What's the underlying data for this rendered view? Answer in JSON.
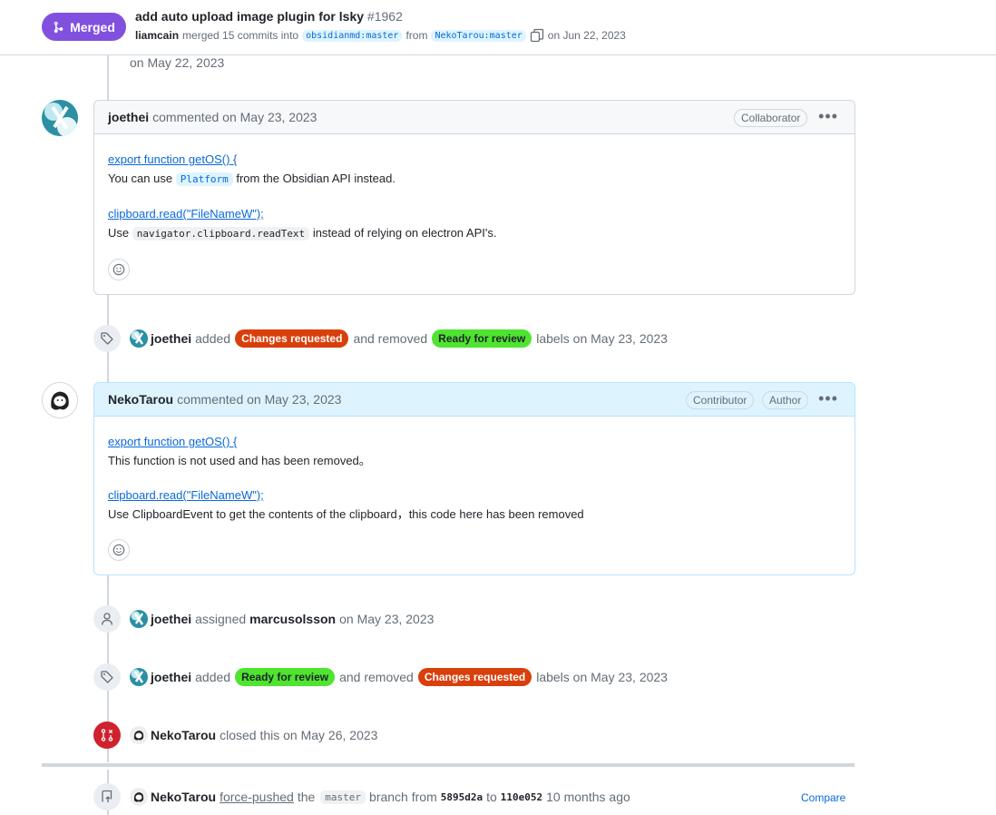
{
  "header": {
    "status": "Merged",
    "title": "add auto upload image plugin for lsky",
    "number": "#1962",
    "merger": "liamcain",
    "merged_text": "merged 15 commits into",
    "base_branch": "obsidianmd:master",
    "from_text": "from",
    "head_branch": "NekoTarou:master",
    "date_text": "on Jun 22, 2023"
  },
  "prev_date": "on May 22, 2023",
  "comment1": {
    "author": "joethei",
    "meta": "commented on May 23, 2023",
    "role": "Collaborator",
    "link1": "export function getOS() {",
    "line1_pre": "You can use",
    "line1_code": "Platform",
    "line1_post": "from the Obsidian API instead.",
    "link2": "clipboard.read(\"FileNameW\");",
    "line2_pre": "Use",
    "line2_code": "navigator.clipboard.readText",
    "line2_post": "instead of relying on electron API's."
  },
  "event1": {
    "actor": "joethei",
    "added": "added",
    "label_a": "Changes requested",
    "removed": "and removed",
    "label_b": "Ready for review",
    "tail": "labels on May 23, 2023"
  },
  "comment2": {
    "author": "NekoTarou",
    "meta": "commented on May 23, 2023",
    "role1": "Contributor",
    "role2": "Author",
    "link1": "export function getOS() {",
    "line1": "This function is not used and has been removed。",
    "link2": "clipboard.read(\"FileNameW\");",
    "line2": "Use ClipboardEvent to get the contents of the clipboard，this code here has been removed"
  },
  "event2": {
    "actor": "joethei",
    "assigned": "assigned",
    "assignee": "marcusolsson",
    "tail": "on May 23, 2023"
  },
  "event3": {
    "actor": "joethei",
    "added": "added",
    "label_a": "Ready for review",
    "removed": "and removed",
    "label_b": "Changes requested",
    "tail": "labels on May 23, 2023"
  },
  "event4": {
    "actor": "NekoTarou",
    "tail": "closed this on May 26, 2023"
  },
  "event5": {
    "actor": "NekoTarou",
    "action": "force-pushed",
    "the": "the",
    "branch": "master",
    "from_text": "branch from",
    "from_sha": "5895d2a",
    "to_text": "to",
    "to_sha": "110e052",
    "ago": "10 months ago",
    "compare": "Compare"
  },
  "colors": {
    "merged": "#8250df",
    "changes_requested": "#d93f0b",
    "ready_for_review": "#4ee42f",
    "closed": "#cf222e",
    "link": "#0969da"
  }
}
